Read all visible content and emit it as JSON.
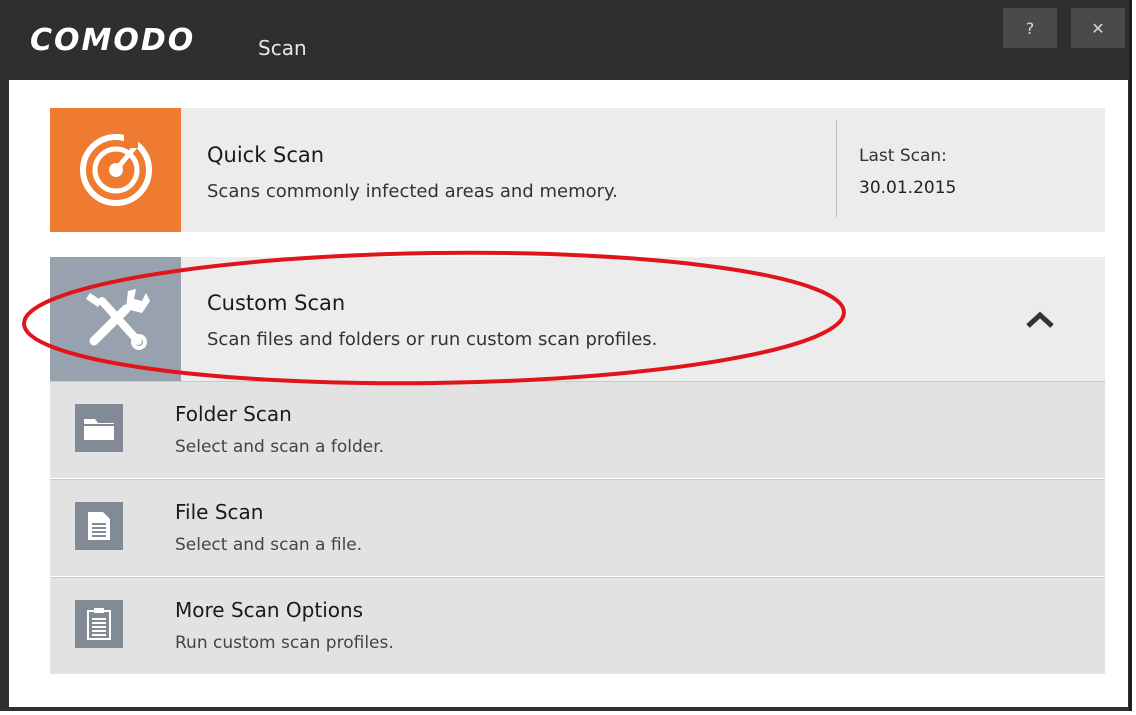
{
  "window": {
    "brand": "COMODO",
    "title": "Scan",
    "help_label": "?",
    "close_label": "✕"
  },
  "quick_scan": {
    "icon": "radar-icon",
    "title": "Quick Scan",
    "description": "Scans commonly infected areas and memory.",
    "last_scan_label": "Last Scan:",
    "last_scan_value": "30.01.2015"
  },
  "custom_scan": {
    "icon": "tools-icon",
    "title": "Custom Scan",
    "description": "Scan files and folders or run custom scan profiles.",
    "expand_icon": "chevron-up-icon"
  },
  "sub_options": [
    {
      "icon": "folder-icon",
      "title": "Folder Scan",
      "description": "Select and scan a folder."
    },
    {
      "icon": "file-icon",
      "title": "File Scan",
      "description": "Select and scan a file."
    },
    {
      "icon": "clipboard-icon",
      "title": "More Scan Options",
      "description": "Run custom scan profiles."
    }
  ],
  "colors": {
    "quick_tile": "#ee7b30",
    "custom_tile": "#98a2ae",
    "highlight_ellipse": "#e0141b",
    "titlebar": "#2f2f2f"
  }
}
